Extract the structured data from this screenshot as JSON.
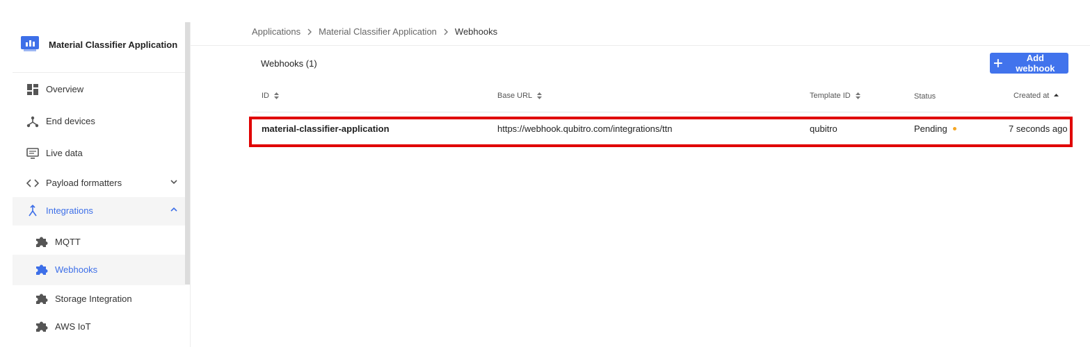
{
  "app": {
    "name": "Material Classifier Application"
  },
  "breadcrumb": {
    "items": [
      "Applications",
      "Material Classifier Application",
      "Webhooks"
    ]
  },
  "sidebar": {
    "items": [
      {
        "label": "Overview",
        "icon": "dashboard-icon"
      },
      {
        "label": "End devices",
        "icon": "devices-icon"
      },
      {
        "label": "Live data",
        "icon": "monitor-icon"
      },
      {
        "label": "Payload formatters",
        "icon": "code-icon"
      },
      {
        "label": "Integrations",
        "icon": "merge-icon"
      }
    ],
    "subitems": [
      {
        "label": "MQTT",
        "icon": "puzzle-icon"
      },
      {
        "label": "Webhooks",
        "icon": "puzzle-icon"
      },
      {
        "label": "Storage Integration",
        "icon": "puzzle-icon"
      },
      {
        "label": "AWS IoT",
        "icon": "puzzle-icon"
      }
    ]
  },
  "main": {
    "title": "Webhooks (1)",
    "add_button": "Add webhook",
    "columns": [
      "ID",
      "Base URL",
      "Template ID",
      "Status",
      "Created at"
    ],
    "rows": [
      {
        "id": "material-classifier-application",
        "base_url": "https://webhook.qubitro.com/integrations/ttn",
        "template_id": "qubitro",
        "status": "Pending",
        "created_at": "7 seconds ago"
      }
    ]
  },
  "colors": {
    "accent": "#4173ec",
    "highlight_border": "#e00000",
    "status_pending": "#f5a623"
  }
}
